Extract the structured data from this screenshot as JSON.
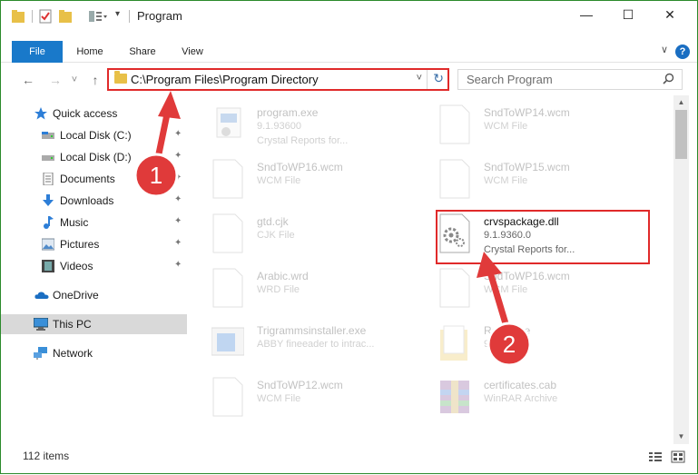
{
  "window": {
    "title": "Program",
    "minimize_glyph": "—",
    "maximize_glyph": "☐",
    "close_glyph": "✕"
  },
  "ribbon": {
    "tabs": [
      "File",
      "Home",
      "Share",
      "View"
    ],
    "help_glyph": "?",
    "expand_glyph": "∨"
  },
  "nav": {
    "back_glyph": "←",
    "forward_glyph": "→",
    "recent_glyph": "˅",
    "up_glyph": "↑",
    "address": "C:\\Program Files\\Program Directory",
    "address_dropdown_glyph": "˅",
    "refresh_glyph": "↻",
    "search_placeholder": "Search Program"
  },
  "sidebar": {
    "items": [
      {
        "label": "Quick access",
        "icon": "star-icon",
        "pinned": false
      },
      {
        "label": "Local Disk (C:)",
        "icon": "drive-icon",
        "pinned": true
      },
      {
        "label": "Local Disk (D:)",
        "icon": "drive-icon",
        "pinned": true
      },
      {
        "label": "Documents",
        "icon": "documents-icon",
        "pinned": true
      },
      {
        "label": "Downloads",
        "icon": "download-icon",
        "pinned": true
      },
      {
        "label": "Music",
        "icon": "music-icon",
        "pinned": true
      },
      {
        "label": "Pictures",
        "icon": "pictures-icon",
        "pinned": true
      },
      {
        "label": "Videos",
        "icon": "videos-icon",
        "pinned": true
      },
      {
        "label": "OneDrive",
        "icon": "cloud-icon",
        "pinned": false
      },
      {
        "label": "This PC",
        "icon": "computer-icon",
        "pinned": false,
        "selected": true
      },
      {
        "label": "Network",
        "icon": "network-icon",
        "pinned": false
      }
    ],
    "pin_glyph": "📌"
  },
  "files": [
    {
      "name": "program.exe",
      "sub": "9.1.93600",
      "sub2": "Crystal Reports for...",
      "icon": "exe-icon"
    },
    {
      "name": "SndToWP14.wcm",
      "sub": "WCM File",
      "sub2": "",
      "icon": "file-icon"
    },
    {
      "name": "SndToWP16.wcm",
      "sub": "WCM File",
      "sub2": "",
      "icon": "file-icon"
    },
    {
      "name": "SndToWP15.wcm",
      "sub": "WCM File",
      "sub2": "",
      "icon": "file-icon"
    },
    {
      "name": "gtd.cjk",
      "sub": "CJK File",
      "sub2": "",
      "icon": "file-icon"
    },
    {
      "name": "crvspackage.dll",
      "sub": "9.1.9360.0",
      "sub2": "Crystal Reports for...",
      "icon": "dll-gear-icon",
      "selected": true
    },
    {
      "name": "Arabic.wrd",
      "sub": "WRD File",
      "sub2": "",
      "icon": "file-icon"
    },
    {
      "name": "SndToWP16.wcm",
      "sub": "WCM File",
      "sub2": "",
      "icon": "file-icon"
    },
    {
      "name": "Trigrammsinstaller.exe",
      "sub": "ABBY fineeader to intrac...",
      "sub2": "",
      "icon": "installer-icon"
    },
    {
      "name": "Resource",
      "sub": "9.1.9360.0",
      "sub2": "",
      "icon": "folder-doc-icon"
    },
    {
      "name": "SndToWP12.wcm",
      "sub": "WCM File",
      "sub2": "",
      "icon": "file-icon"
    },
    {
      "name": "certificates.cab",
      "sub": "WinRAR Archive",
      "sub2": "",
      "icon": "winrar-icon"
    }
  ],
  "callouts": [
    {
      "number": "1",
      "color": "#e03a3a"
    },
    {
      "number": "2",
      "color": "#e03a3a"
    }
  ],
  "status": {
    "item_count": "112 items"
  },
  "colors": {
    "accent": "#1979ca",
    "highlight": "#e02a2a",
    "window_border": "#2b8a2b"
  }
}
